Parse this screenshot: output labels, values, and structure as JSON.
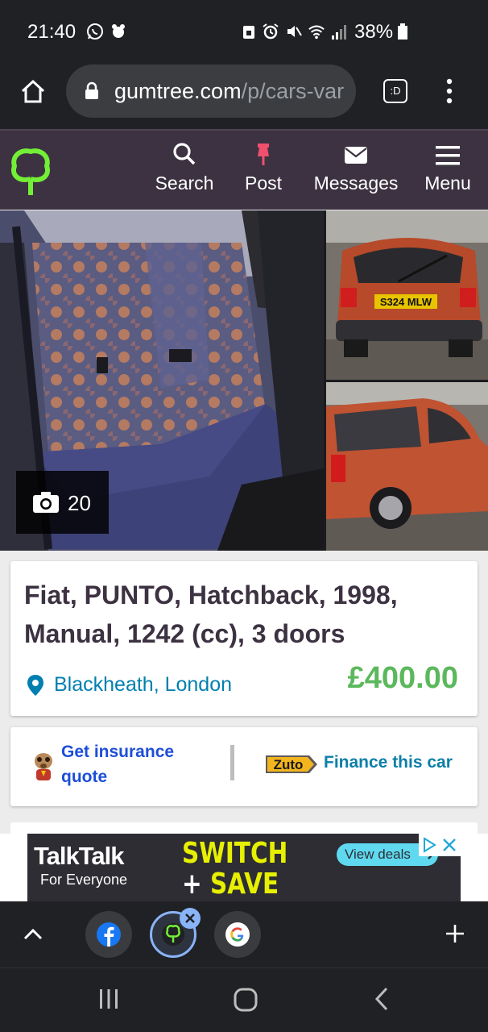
{
  "status_bar": {
    "time": "21:40",
    "battery": "38%"
  },
  "browser": {
    "url_main": "gumtree.com",
    "url_rest": "/p/cars-var",
    "tab_switcher_label": ":D"
  },
  "gumtree_nav": {
    "search": "Search",
    "post": "Post",
    "messages": "Messages",
    "menu": "Menu"
  },
  "photos": {
    "count": "20"
  },
  "listing": {
    "title": "Fiat, PUNTO, Hatchback, 1998, Manual, 1242 (cc), 3 doors",
    "location": "Blackheath, London",
    "price": "£400.00"
  },
  "services": {
    "insurance": "Get insurance quote",
    "zuto": "Zuto",
    "finance": "Finance this car"
  },
  "ad": {
    "brand": "TalkTalk",
    "tagline": "For Everyone",
    "headline1": "SWITCH",
    "plus": "+",
    "headline2": "SAVE",
    "cta": "View deals"
  },
  "rear_plate": "S324 MLW",
  "colors": {
    "gumtree_nav_bg": "#3c3241",
    "gumtree_green": "#72ef36",
    "post_pin": "#f0506e",
    "price_green": "#5cb85c",
    "link_blue": "#007fb0",
    "ad_yellow": "#e6f000",
    "ad_cyan": "#5fd9f0"
  }
}
